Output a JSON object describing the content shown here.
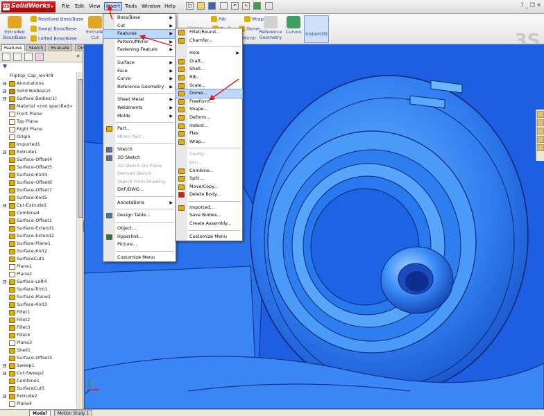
{
  "app": {
    "logo": "SolidWorks"
  },
  "menubar": {
    "items": [
      "File",
      "Edit",
      "View",
      "Insert",
      "Tools",
      "Window",
      "Help"
    ]
  },
  "command_manager": {
    "extruded_boss": "Extruded Boss/Base",
    "revolved_boss": "Revolved Boss/Base",
    "swept_boss": "Swept Boss/Base",
    "lofted_boss": "Lofted Boss/Base",
    "extruded_cut": "Extruded Cut",
    "rib": "Rib",
    "wrap": "Wrap",
    "linear": "Linear",
    "draft": "Draft",
    "dome": "Dome",
    "mirror": "Mirror",
    "reference_geometry": "Reference Geometry",
    "curves": "Curves",
    "instant3d": "Instant3D"
  },
  "tabs": [
    "Features",
    "Sketch",
    "Evaluate",
    "DimXpert"
  ],
  "bottom_tabs": [
    "Model",
    "Motion Study 1"
  ],
  "tree": {
    "root": "Fliptop_Cap_rev4r8",
    "items": [
      {
        "label": "Annotations",
        "expand": true,
        "icon": "#e0b000"
      },
      {
        "label": "Solid Bodies(2)",
        "expand": true,
        "icon": "#c08020"
      },
      {
        "label": "Surface Bodies(1)",
        "expand": true,
        "icon": "#e0b000"
      },
      {
        "label": "Material <not specified>",
        "expand": false,
        "icon": "#c0a060"
      },
      {
        "label": "Front Plane",
        "expand": false,
        "icon": "#ffffff"
      },
      {
        "label": "Top Plane",
        "expand": false,
        "icon": "#ffffff"
      },
      {
        "label": "Right Plane",
        "expand": false,
        "icon": "#ffffff"
      },
      {
        "label": "Origin",
        "expand": false,
        "icon": "#ffffff"
      },
      {
        "label": "Imported1",
        "expand": false,
        "icon": "#e0b000"
      },
      {
        "label": "Extrude1",
        "expand": true,
        "icon": "#e0b000"
      },
      {
        "label": "Surface-Offset4",
        "expand": false,
        "icon": "#e0b000"
      },
      {
        "label": "Surface-Offset5",
        "expand": false,
        "icon": "#e0b000"
      },
      {
        "label": "Surface-Knit4",
        "expand": false,
        "icon": "#e0b000"
      },
      {
        "label": "Surface-Offset6",
        "expand": false,
        "icon": "#e0b000"
      },
      {
        "label": "Surface-Offset7",
        "expand": false,
        "icon": "#e0b000"
      },
      {
        "label": "Surface-Knit5",
        "expand": false,
        "icon": "#e0b000"
      },
      {
        "label": "Cut-Extrude1",
        "expand": true,
        "icon": "#e0b000"
      },
      {
        "label": "Combine4",
        "expand": false,
        "icon": "#e0b000"
      },
      {
        "label": "Surface-Offset1",
        "expand": false,
        "icon": "#e0b000"
      },
      {
        "label": "Surface-Extend1",
        "expand": false,
        "icon": "#e0b000"
      },
      {
        "label": "Surface-Extend2",
        "expand": false,
        "icon": "#e0b000"
      },
      {
        "label": "Surface-Plane1",
        "expand": false,
        "icon": "#e0b000"
      },
      {
        "label": "Surface-Knit2",
        "expand": false,
        "icon": "#e0b000"
      },
      {
        "label": "SurfaceCut1",
        "expand": false,
        "icon": "#e0b000"
      },
      {
        "label": "Plane1",
        "expand": false,
        "icon": "#ffffff"
      },
      {
        "label": "Plane2",
        "expand": false,
        "icon": "#ffffff"
      },
      {
        "label": "Surface-Loft4",
        "expand": true,
        "icon": "#e0b000"
      },
      {
        "label": "Surface-Trim1",
        "expand": false,
        "icon": "#e0b000"
      },
      {
        "label": "Surface-Plane2",
        "expand": false,
        "icon": "#e0b000"
      },
      {
        "label": "Surface-Knit3",
        "expand": false,
        "icon": "#e0b000"
      },
      {
        "label": "Fillet1",
        "expand": false,
        "icon": "#e0b000"
      },
      {
        "label": "Fillet2",
        "expand": false,
        "icon": "#e0b000"
      },
      {
        "label": "Fillet3",
        "expand": false,
        "icon": "#e0b000"
      },
      {
        "label": "Fillet4",
        "expand": false,
        "icon": "#e0b000"
      },
      {
        "label": "Plane3",
        "expand": false,
        "icon": "#ffffff"
      },
      {
        "label": "Shell1",
        "expand": false,
        "icon": "#e0b000"
      },
      {
        "label": "Surface-Offset3",
        "expand": false,
        "icon": "#e0b000"
      },
      {
        "label": "Sweep1",
        "expand": true,
        "icon": "#e0b000"
      },
      {
        "label": "Cut-Sweep2",
        "expand": true,
        "icon": "#e0b000"
      },
      {
        "label": "Combine1",
        "expand": false,
        "icon": "#e0b000"
      },
      {
        "label": "SurfaceCut5",
        "expand": false,
        "icon": "#e0b000"
      },
      {
        "label": "Extrude2",
        "expand": true,
        "icon": "#e0b000"
      },
      {
        "label": "Plane4",
        "expand": false,
        "icon": "#ffffff"
      }
    ]
  },
  "insert_menu": {
    "items": [
      {
        "label": "Boss/Base",
        "sub": true,
        "disabled": false,
        "hl": false,
        "icon": ""
      },
      {
        "label": "Cut",
        "sub": true,
        "disabled": false,
        "hl": false,
        "icon": ""
      },
      {
        "label": "Features",
        "sub": true,
        "disabled": false,
        "hl": true,
        "icon": ""
      },
      {
        "label": "Pattern/Mirror",
        "sub": true,
        "disabled": false,
        "hl": false,
        "icon": ""
      },
      {
        "label": "Fastening Feature",
        "sub": true,
        "disabled": false,
        "hl": false,
        "icon": ""
      },
      {
        "sep": true
      },
      {
        "label": "Surface",
        "sub": true,
        "disabled": false,
        "hl": false,
        "icon": ""
      },
      {
        "label": "Face",
        "sub": true,
        "disabled": false,
        "hl": false,
        "icon": ""
      },
      {
        "label": "Curve",
        "sub": true,
        "disabled": false,
        "hl": false,
        "icon": ""
      },
      {
        "label": "Reference Geometry",
        "sub": true,
        "disabled": false,
        "hl": false,
        "icon": ""
      },
      {
        "sep": true
      },
      {
        "label": "Sheet Metal",
        "sub": true,
        "disabled": false,
        "hl": false,
        "icon": ""
      },
      {
        "label": "Weldments",
        "sub": true,
        "disabled": false,
        "hl": false,
        "icon": ""
      },
      {
        "label": "Molds",
        "sub": true,
        "disabled": false,
        "hl": false,
        "icon": ""
      },
      {
        "sep": true
      },
      {
        "label": "Part...",
        "sub": false,
        "disabled": false,
        "hl": false,
        "icon": "#e0b000"
      },
      {
        "label": "Mirror Part...",
        "sub": false,
        "disabled": true,
        "hl": false,
        "icon": ""
      },
      {
        "sep": true
      },
      {
        "label": "Sketch",
        "sub": false,
        "disabled": false,
        "hl": false,
        "icon": "#5070c0"
      },
      {
        "label": "3D Sketch",
        "sub": false,
        "disabled": false,
        "hl": false,
        "icon": "#5070c0"
      },
      {
        "label": "3D Sketch On Plane",
        "sub": false,
        "disabled": true,
        "hl": false,
        "icon": ""
      },
      {
        "label": "Derived Sketch",
        "sub": false,
        "disabled": true,
        "hl": false,
        "icon": ""
      },
      {
        "label": "Sketch From Drawing",
        "sub": false,
        "disabled": true,
        "hl": false,
        "icon": ""
      },
      {
        "label": "DXF/DWG...",
        "sub": false,
        "disabled": false,
        "hl": false,
        "icon": ""
      },
      {
        "sep": true
      },
      {
        "label": "Annotations",
        "sub": true,
        "disabled": false,
        "hl": false,
        "icon": ""
      },
      {
        "sep": true
      },
      {
        "label": "Design Table...",
        "sub": false,
        "disabled": false,
        "hl": false,
        "icon": "#3080c0"
      },
      {
        "sep": true
      },
      {
        "label": "Object...",
        "sub": false,
        "disabled": false,
        "hl": false,
        "icon": ""
      },
      {
        "label": "Hyperlink...",
        "sub": false,
        "disabled": false,
        "hl": false,
        "icon": "#208040"
      },
      {
        "label": "Picture...",
        "sub": false,
        "disabled": false,
        "hl": false,
        "icon": ""
      },
      {
        "sep": true
      },
      {
        "label": "Customize Menu",
        "sub": false,
        "disabled": false,
        "hl": false,
        "icon": ""
      }
    ]
  },
  "features_menu": {
    "items": [
      {
        "label": "Fillet/Round...",
        "sub": false,
        "disabled": false,
        "hl": false,
        "icon": "#e0b000"
      },
      {
        "label": "Chamfer...",
        "sub": false,
        "disabled": false,
        "hl": false,
        "icon": "#e0b000"
      },
      {
        "sep": true
      },
      {
        "label": "Hole",
        "sub": true,
        "disabled": false,
        "hl": false,
        "icon": ""
      },
      {
        "label": "Draft...",
        "sub": false,
        "disabled": false,
        "hl": false,
        "icon": "#e0b000"
      },
      {
        "label": "Shell...",
        "sub": false,
        "disabled": false,
        "hl": false,
        "icon": "#e0b000"
      },
      {
        "label": "Rib...",
        "sub": false,
        "disabled": false,
        "hl": false,
        "icon": "#e0b000"
      },
      {
        "label": "Scale...",
        "sub": false,
        "disabled": false,
        "hl": false,
        "icon": "#e0b000"
      },
      {
        "label": "Dome...",
        "sub": false,
        "disabled": false,
        "hl": true,
        "icon": "#e0b000"
      },
      {
        "label": "Freeform...",
        "sub": false,
        "disabled": false,
        "hl": false,
        "icon": "#e0b000"
      },
      {
        "label": "Shape...",
        "sub": false,
        "disabled": false,
        "hl": false,
        "icon": "#e0b000"
      },
      {
        "label": "Deform...",
        "sub": false,
        "disabled": false,
        "hl": false,
        "icon": "#e0b000"
      },
      {
        "label": "Indent...",
        "sub": false,
        "disabled": false,
        "hl": false,
        "icon": "#e0b000"
      },
      {
        "label": "Flex",
        "sub": false,
        "disabled": false,
        "hl": false,
        "icon": "#e0b000"
      },
      {
        "label": "Wrap...",
        "sub": false,
        "disabled": false,
        "hl": false,
        "icon": "#e0b000"
      },
      {
        "sep": true
      },
      {
        "label": "Cavity...",
        "sub": false,
        "disabled": true,
        "hl": false,
        "icon": ""
      },
      {
        "label": "Join...",
        "sub": false,
        "disabled": true,
        "hl": false,
        "icon": ""
      },
      {
        "label": "Combine...",
        "sub": false,
        "disabled": false,
        "hl": false,
        "icon": "#e0b000"
      },
      {
        "label": "Split...",
        "sub": false,
        "disabled": false,
        "hl": false,
        "icon": "#e0b000"
      },
      {
        "label": "Move/Copy...",
        "sub": false,
        "disabled": false,
        "hl": false,
        "icon": "#e0b000"
      },
      {
        "label": "Delete Body...",
        "sub": false,
        "disabled": false,
        "hl": false,
        "icon": "#d02020"
      },
      {
        "sep": true
      },
      {
        "label": "Imported...",
        "sub": false,
        "disabled": false,
        "hl": false,
        "icon": "#e0b000"
      },
      {
        "label": "Save Bodies...",
        "sub": false,
        "disabled": false,
        "hl": false,
        "icon": ""
      },
      {
        "label": "Create Assembly...",
        "sub": false,
        "disabled": false,
        "hl": false,
        "icon": ""
      },
      {
        "sep": true
      },
      {
        "label": "Customize Menu",
        "sub": false,
        "disabled": false,
        "hl": false,
        "icon": ""
      }
    ]
  },
  "colors": {
    "viewport_bg": "#1d5fe0",
    "model_light": "#5aa8ff",
    "model_mid": "#2f7df0",
    "model_dark": "#1448c0",
    "annotation_arrow": "#e01818",
    "menu_highlight": "#c0d8f8"
  }
}
